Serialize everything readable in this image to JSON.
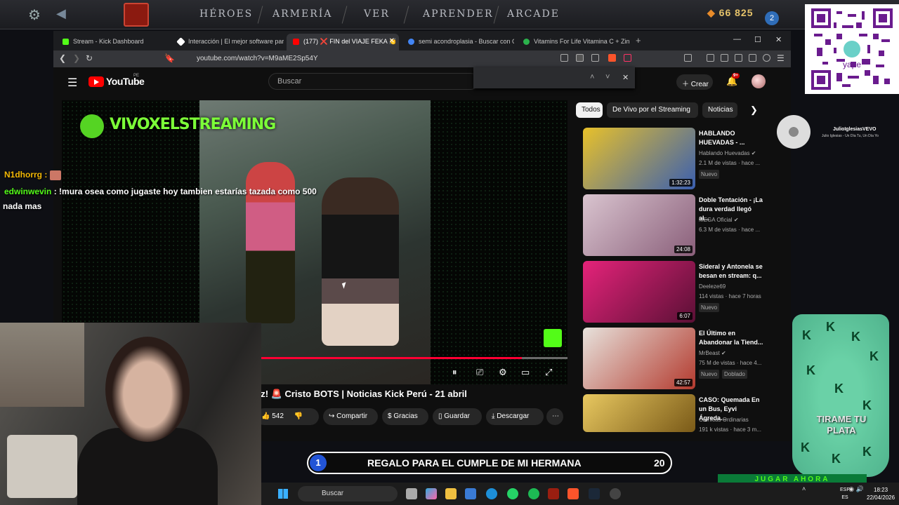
{
  "game": {
    "nav": [
      "HÉROES",
      "ARMERÍA",
      "VER",
      "APRENDER",
      "ARCADE"
    ],
    "shards": "66 825",
    "badge": "2"
  },
  "qr": {
    "label": "yape"
  },
  "browser": {
    "tabs": [
      {
        "label": "Stream - Kick Dashboard",
        "color": "#53fc18"
      },
      {
        "label": "Interacción | El mejor software para p",
        "color": "#ffffff"
      },
      {
        "label": "(177) ❌ FIN del VIAJE FEKA 👏",
        "color": "#ff0000"
      },
      {
        "label": "semi acondroplasia - Buscar con Goo",
        "color": "#4285f4"
      },
      {
        "label": "Vitamins For Life Vitamina C + Zinc N",
        "color": "#2bb24c"
      }
    ],
    "url": "youtube.com/watch?v=M9aME2Sp54Y"
  },
  "youtube": {
    "brand": "YouTube",
    "country": "PE",
    "search_placeholder": "Buscar",
    "create_label": "Crear",
    "notif_count": "9+",
    "player": {
      "overlay_brand": "VIVOXELSTREAMING",
      "progress": 0.91
    },
    "video_title": "ez! 🚨 Cristo BOTS | Noticias Kick Perú - 21 abril",
    "actions": {
      "likes": "542",
      "share": "Compartir",
      "thanks": "Gracias",
      "save": "Guardar",
      "download": "Descargar"
    },
    "chips": [
      "Todos",
      "De Vivo por el Streaming",
      "Noticias"
    ],
    "recommendations": [
      {
        "title": "HABLANDO HUEVADAS - ...",
        "channel": "Hablando Huevadas",
        "views": "2.1 M de vistas · hace ...",
        "badge": "Nuevo",
        "badge2": "",
        "duration": "1:32:23",
        "thumb": "#3a5fb0"
      },
      {
        "title": "Doble Tentación - ¡La dura verdad llegó al...",
        "channel": "MEGA Oficial",
        "views": "6.3 M de vistas · hace ...",
        "badge": "",
        "badge2": "",
        "duration": "24:08",
        "thumb": "#b88fa8"
      },
      {
        "title": "Sideral y Antonela se besan en stream: q...",
        "channel": "Deeleze69",
        "views": "114 vistas · hace 7 horas",
        "badge": "Nuevo",
        "badge2": "",
        "duration": "6:07",
        "thumb": "#c2367a"
      },
      {
        "title": "El Último en Abandonar la Tiend...",
        "channel": "MrBeast",
        "views": "75 M de vistas · hace 4...",
        "badge": "Nuevo",
        "badge2": "Doblado",
        "duration": "42:57",
        "thumb": "#c7c0b8"
      },
      {
        "title": "CASO: Quemada En un Bus, Eyvi Ágreda...",
        "channel": "Crónicas Ordinarias",
        "views": "191 k vistas · hace 3 m...",
        "badge": "",
        "badge2": "",
        "duration": "",
        "thumb": "#b8962e"
      }
    ]
  },
  "chat": [
    {
      "user": "N1dhorrg",
      "message": "",
      "color": "#f2b705"
    },
    {
      "user": "edwinwevin",
      "message": "!mura osea como jugaste hoy tambien estarías tazada como 500",
      "color": "#53fc18"
    },
    {
      "user": "",
      "message": "nada mas",
      "color": "#ffffff"
    }
  ],
  "song": {
    "artist": "JulioIglesiasVEVO",
    "track": "Julio Iglesias - Un Día Tu, Un Día Yo"
  },
  "goal": {
    "number": "1",
    "label": "REGALO PARA EL CUMPLE DE MI HERMANA",
    "count": "20"
  },
  "bucket": {
    "text": "TIRAME TU PLATA",
    "button": "JUGAR AHORA"
  },
  "taskbar": {
    "search": "Buscar",
    "lang": "ESP",
    "region": "ES",
    "time": "18:23",
    "date": "22/04/2026"
  }
}
